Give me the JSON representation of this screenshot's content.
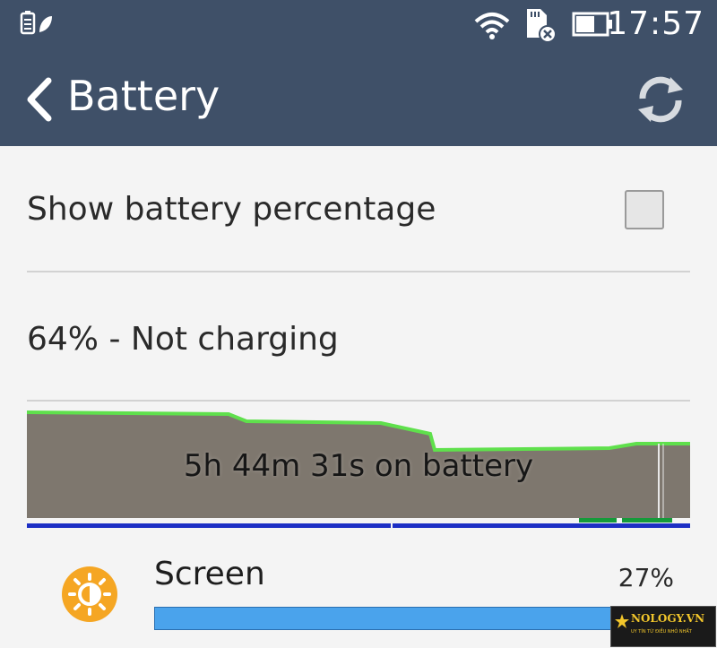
{
  "status_bar": {
    "time": "17:57",
    "icons": [
      "battery-saver-icon",
      "wifi-icon",
      "sd-card-icon",
      "battery-icon"
    ]
  },
  "app_bar": {
    "title": "Battery",
    "icons": [
      "back-arrow-icon",
      "refresh-icon"
    ]
  },
  "settings": {
    "show_percentage_label": "Show battery percentage",
    "show_percentage_checked": false
  },
  "battery": {
    "status_text": "64% - Not charging",
    "graph_caption": "5h 44m 31s on battery",
    "graph_level_fill": "#7e776e",
    "graph_line_color": "#5fe04c",
    "screen_on_color": "#1d2fc4",
    "charging_color": "#159a3a"
  },
  "usage": [
    {
      "name": "Screen",
      "percent": "27%",
      "fraction": 0.27,
      "icon": "brightness-icon",
      "icon_color": "#f5a623"
    }
  ],
  "watermark": {
    "name": "NOLOGY.VN",
    "tagline": "UY TÍN TỪ ĐIỀU NHỎ NHẤT"
  }
}
